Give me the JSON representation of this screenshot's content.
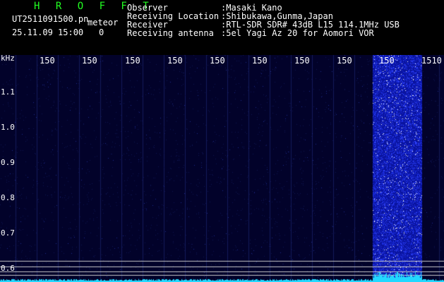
{
  "header": {
    "app_title": "H R O F F T",
    "filename": "UT2511091500.pn",
    "meteor_label": "meteor",
    "datetime": "25.11.09 15:00",
    "meteor_count": "0",
    "fields": [
      {
        "label": "Observer",
        "value": ":Masaki Kano"
      },
      {
        "label": "Receiving Location",
        "value": ":Shibukawa,Gunma,Japan"
      },
      {
        "label": "Receiver",
        "value": ":RTL-SDR SDR# 43dB L15 114.1MHz USB"
      },
      {
        "label": "Receiving antenna",
        "value": ":5el Yagi Az 20 for Aomori VOR"
      }
    ]
  },
  "waterfall": {
    "y_unit": "kHz",
    "y_ticks": [
      "1.1",
      "1.0",
      "0.9",
      "0.8",
      "0.7",
      "0.6"
    ],
    "x_ticks": [
      "150",
      "150",
      "150",
      "150",
      "150",
      "150",
      "150",
      "150",
      "150",
      "1510"
    ],
    "colors": {
      "background": "#02022a",
      "grid": "#141a5a",
      "noise": "#3344ff",
      "trace": "#22d8ff",
      "hline": "#c8c8c8"
    }
  }
}
